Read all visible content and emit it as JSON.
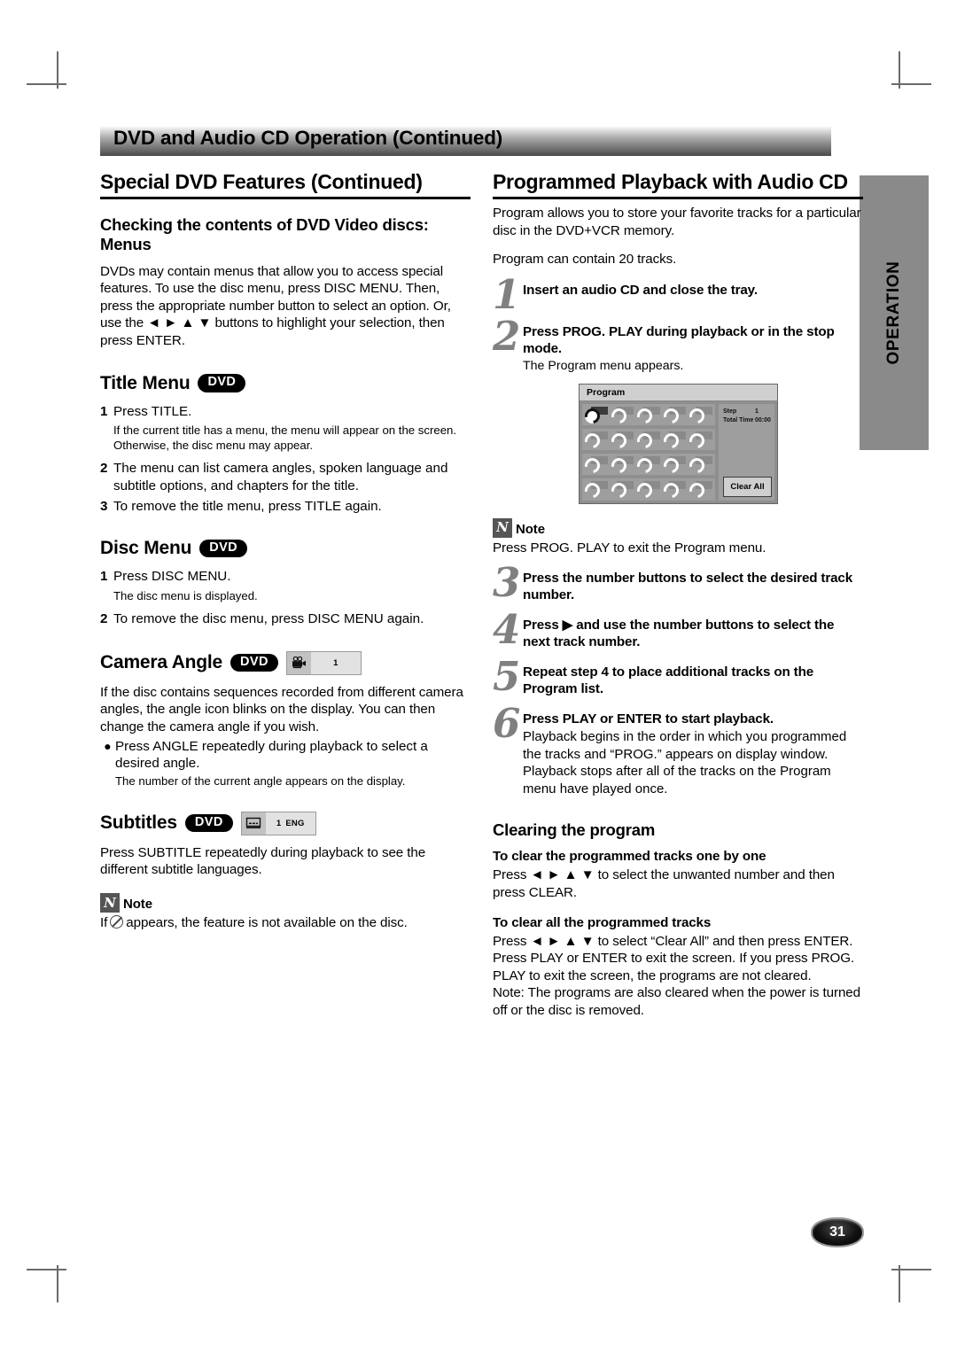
{
  "page": {
    "banner_title": "DVD and Audio CD Operation (Continued)",
    "side_tab_label": "OPERATION",
    "page_number": "31"
  },
  "left_column": {
    "section_title": "Special DVD Features (Continued)",
    "checking": {
      "heading": "Checking the contents of DVD Video discs: Menus",
      "paragraph": "DVDs may contain menus that allow you to access special features. To use the disc menu, press DISC MENU. Then, press the appropriate number button to select an option. Or, use the ◄ ► ▲ ▼ buttons to highlight your selection, then press ENTER."
    },
    "title_menu": {
      "heading": "Title Menu",
      "badge": "DVD",
      "steps": [
        {
          "n": "1",
          "text": "Press TITLE.",
          "sub": "If the current title has a menu, the menu will appear on the screen. Otherwise, the disc menu may appear."
        },
        {
          "n": "2",
          "text": "The menu can list camera angles, spoken language and subtitle options, and chapters for the title.",
          "sub": ""
        },
        {
          "n": "3",
          "text": "To remove the title menu, press TITLE again.",
          "sub": ""
        }
      ]
    },
    "disc_menu": {
      "heading": "Disc Menu",
      "badge": "DVD",
      "steps": [
        {
          "n": "1",
          "text": "Press DISC MENU.",
          "sub": "The disc menu is displayed."
        },
        {
          "n": "2",
          "text": "To remove the disc menu, press DISC MENU again.",
          "sub": ""
        }
      ]
    },
    "camera_angle": {
      "heading": "Camera Angle",
      "badge": "DVD",
      "osd_icon_name": "camera-angle-osd-icon",
      "osd_value": "1",
      "paragraph": "If the disc contains sequences recorded from different camera angles, the angle icon blinks on the display. You can then change the camera angle if you wish.",
      "bullet": "Press ANGLE repeatedly during playback to select a desired angle.",
      "bullet_sub": "The number of the current angle appears on the display."
    },
    "subtitles": {
      "heading": "Subtitles",
      "badge": "DVD",
      "osd_icon_name": "subtitle-osd-icon",
      "osd_value": "1",
      "osd_lang": "ENG",
      "paragraph": "Press SUBTITLE repeatedly during playback to see the different subtitle languages."
    },
    "note": {
      "label": "Note",
      "text_before": "If",
      "text_after": "appears, the feature is not available on the disc."
    }
  },
  "right_column": {
    "section_title": "Programmed Playback with Audio CD",
    "intro1": "Program allows you to store your favorite tracks for a particular disc in the DVD+VCR memory.",
    "intro2": "Program can contain 20 tracks.",
    "steps": [
      {
        "n": "1",
        "title": "Insert an audio CD and close the tray.",
        "desc": ""
      },
      {
        "n": "2",
        "title": "Press PROG. PLAY during playback or in the stop mode.",
        "desc": "The Program menu appears."
      },
      {
        "n": "3",
        "title": "Press the number buttons to select the desired track number.",
        "desc": ""
      },
      {
        "n": "4",
        "title": "Press ▶ and use the number buttons to select the next track number.",
        "desc": ""
      },
      {
        "n": "5",
        "title": "Repeat step 4 to place additional tracks on the Program list.",
        "desc": ""
      },
      {
        "n": "6",
        "title": "Press PLAY or ENTER to start playback.",
        "desc": "Playback begins in the order in which you programmed the tracks and “PROG.” appears on display window. Playback stops after all of the tracks on the Program menu have played once."
      }
    ],
    "note": {
      "label": "Note",
      "text": "Press PROG. PLAY to exit the Program menu."
    },
    "program_screen": {
      "title": "Program",
      "step_label": "Step",
      "step_value": "1",
      "total_time_label": "Total Time",
      "total_time_value": "00:00",
      "clear_all_label": "Clear All",
      "rows": 4,
      "cols": 5,
      "selected_index": 0
    },
    "clearing": {
      "heading": "Clearing the program",
      "one_by_one_heading": "To clear the programmed tracks one by one",
      "one_by_one_text": "Press ◄ ► ▲ ▼ to select the unwanted number and then press CLEAR.",
      "all_heading": "To clear all the programmed tracks",
      "all_text": "Press ◄ ► ▲ ▼ to select “Clear All” and then press ENTER. Press PLAY or ENTER to exit the screen. If you press PROG. PLAY to exit the screen, the programs are not cleared.",
      "all_note": "Note: The programs are also cleared when the power is turned off or the disc is removed."
    }
  }
}
